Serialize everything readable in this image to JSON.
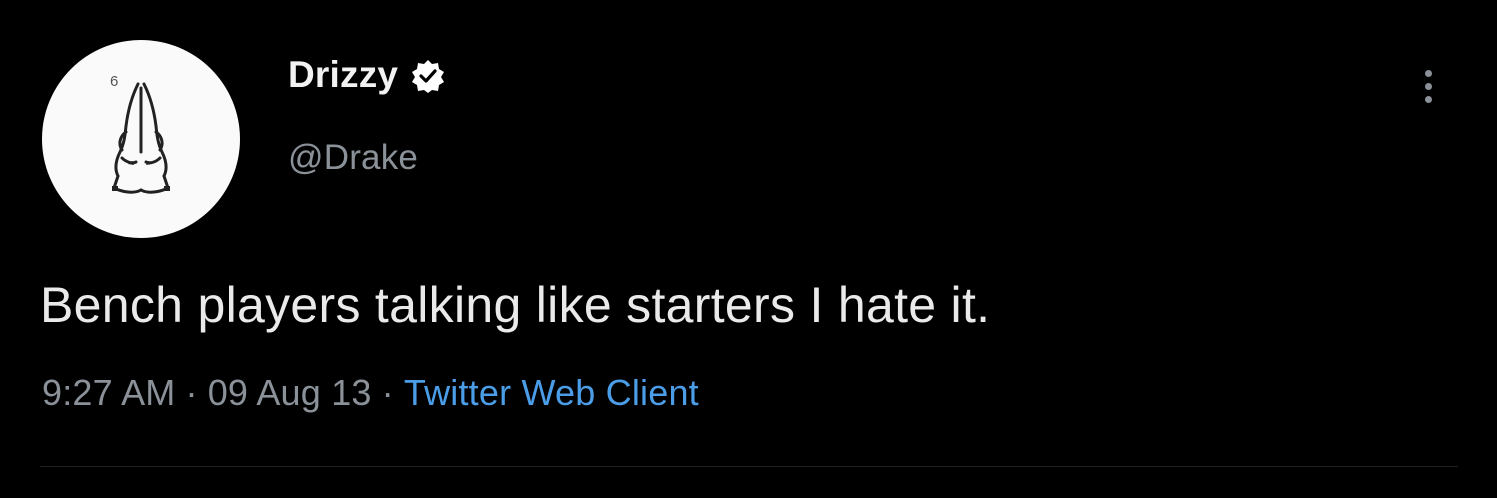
{
  "tweet": {
    "author": {
      "display_name": "Drizzy",
      "handle": "@Drake",
      "verified": true,
      "avatar_icon": "praying-hands-icon",
      "avatar_badge": "6"
    },
    "text": "Bench players talking like starters I hate it.",
    "meta": {
      "time": "9:27 AM",
      "date": "09 Aug 13",
      "separator": "·",
      "source": "Twitter Web Client"
    },
    "menu_icon": "more-vertical-icon"
  },
  "colors": {
    "background": "#000000",
    "primary_text": "#eaeaea",
    "secondary_text": "#8b9198",
    "link": "#4b9de8",
    "verified_badge": "#ffffff"
  }
}
